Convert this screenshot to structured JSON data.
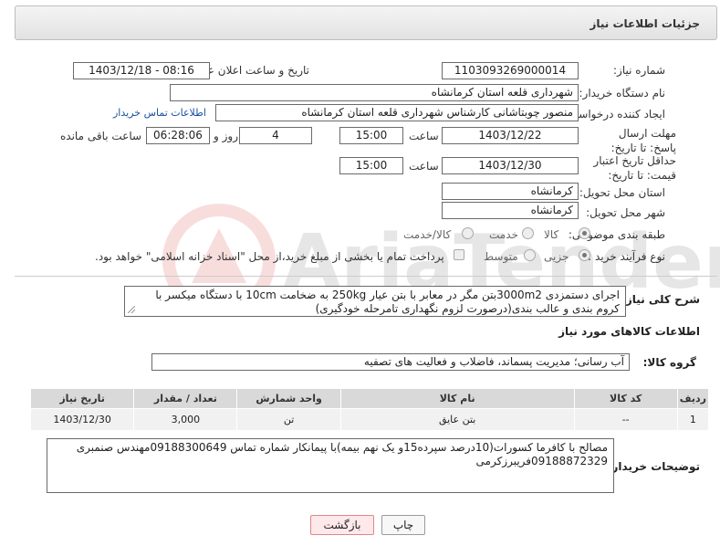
{
  "header": {
    "title": "جزئیات اطلاعات نیاز"
  },
  "need_number": {
    "label": "شماره نیاز:",
    "value": "1103093269000014"
  },
  "announce": {
    "label": "تاریخ و ساعت اعلان عمومی:",
    "value": "1403/12/18 - 08:16"
  },
  "buyer_org": {
    "label": "نام دستگاه خریدار:",
    "value": "شهرداری قلعه استان کرمانشاه"
  },
  "requester": {
    "label": "ایجاد کننده درخواست:",
    "value": "منصور چوبتاشانی کارشناس شهرداری قلعه استان کرمانشاه",
    "contact_link": "اطلاعات تماس خریدار"
  },
  "deadline": {
    "label": "مهلت ارسال پاسخ: تا تاریخ:",
    "date": "1403/12/22",
    "time_label": "ساعت",
    "time": "15:00",
    "days": "4",
    "days_label": "روز و",
    "remaining": "06:28:06",
    "remaining_label": "ساعت باقی مانده"
  },
  "validity": {
    "label": "حداقل تاریخ اعتبار قیمت: تا تاریخ:",
    "date": "1403/12/30",
    "time_label": "ساعت",
    "time": "15:00"
  },
  "province": {
    "label": "استان محل تحویل:",
    "value": "کرمانشاه"
  },
  "city": {
    "label": "شهر محل تحویل:",
    "value": "کرمانشاه"
  },
  "category": {
    "label": "طبقه بندی موضوعی:",
    "options": [
      "کالا",
      "خدمت",
      "کالا/خدمت"
    ],
    "selected": 0
  },
  "process": {
    "label": "نوع فرآیند خرید :",
    "options": [
      "جزیی",
      "متوسط"
    ],
    "selected": 0,
    "payment_note": "پرداخت تمام یا بخشی از مبلغ خرید،از محل \"اسناد خزانه اسلامی\" خواهد بود."
  },
  "description": {
    "label": "شرح کلی نیاز:",
    "text": "اجرای دستمزدی 3000m2بتن مگر در معابر با بتن عیار 250kg به ضخامت 10cm با دستگاه میکسر با کروم بندی و عالب بندی(درصورت لزوم نگهداری تامرحله خودگیری)"
  },
  "goods_info": {
    "heading": "اطلاعات کالاهای مورد نیاز"
  },
  "goods_group": {
    "label": "گروه کالا:",
    "value": "آب رسانی؛ مدیریت پسماند، فاضلاب و فعالیت های تصفیه"
  },
  "table": {
    "headers": [
      "ردیف",
      "کد کالا",
      "نام کالا",
      "واحد شمارش",
      "تعداد / مقدار",
      "تاریخ نیاز"
    ],
    "rows": [
      [
        "1",
        "--",
        "بتن عایق",
        "تن",
        "3,000",
        "1403/12/30"
      ]
    ]
  },
  "buyer_notes": {
    "label": "توضیحات خریدار:",
    "text": "مصالح با کافرما کسورات(10درصد سپرده15و یک نهم بیمه)با پیمانکار شماره تماس 09188300649مهندس صنمبری 09188872329فریبرزکرمی"
  },
  "buttons": {
    "print": "چاپ",
    "back": "بازگشت"
  },
  "colors": {
    "back_button_bg": "#fde8ea",
    "back_button_border": "#d88",
    "print_button_bg": "#f7f7f7"
  }
}
